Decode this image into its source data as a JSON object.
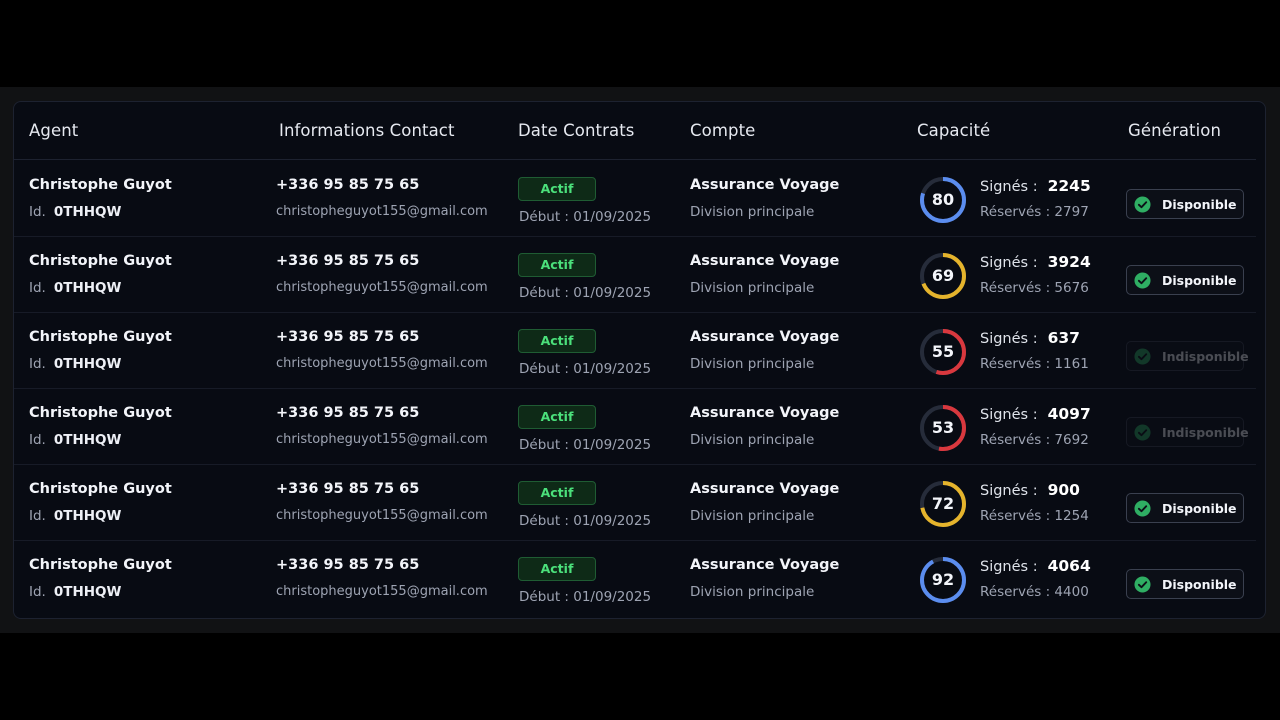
{
  "table": {
    "headers": {
      "agent": "Agent",
      "contact": "Informations Contact",
      "date": "Date Contrats",
      "compte": "Compte",
      "capacite": "Capacité",
      "generation": "Génération"
    },
    "id_prefix": "Id.",
    "signes_label": "Signés :",
    "rows": [
      {
        "name": "Christophe Guyot",
        "id": "0THHQW",
        "phone": "+336 95 85 75 65",
        "email": "christopheguyot155@gmail.com",
        "status": "Actif",
        "debut": "Début : 01/09/2025",
        "account": "Assurance Voyage",
        "division": "Division principale",
        "capacity": 80,
        "ring_color": "#5b8def",
        "signes": "2245",
        "reserves": "Réservés : 2797",
        "generation": "Disponible",
        "available": true
      },
      {
        "name": "Christophe Guyot",
        "id": "0THHQW",
        "phone": "+336 95 85 75 65",
        "email": "christopheguyot155@gmail.com",
        "status": "Actif",
        "debut": "Début : 01/09/2025",
        "account": "Assurance Voyage",
        "division": "Division principale",
        "capacity": 69,
        "ring_color": "#e5b42c",
        "signes": "3924",
        "reserves": "Réservés : 5676",
        "generation": "Disponible",
        "available": true
      },
      {
        "name": "Christophe Guyot",
        "id": "0THHQW",
        "phone": "+336 95 85 75 65",
        "email": "christopheguyot155@gmail.com",
        "status": "Actif",
        "debut": "Début : 01/09/2025",
        "account": "Assurance Voyage",
        "division": "Division principale",
        "capacity": 55,
        "ring_color": "#d9383e",
        "signes": "637",
        "reserves": "Réservés : 1161",
        "generation": "Indisponible",
        "available": false
      },
      {
        "name": "Christophe Guyot",
        "id": "0THHQW",
        "phone": "+336 95 85 75 65",
        "email": "christopheguyot155@gmail.com",
        "status": "Actif",
        "debut": "Début : 01/09/2025",
        "account": "Assurance Voyage",
        "division": "Division principale",
        "capacity": 53,
        "ring_color": "#d9383e",
        "signes": "4097",
        "reserves": "Réservés : 7692",
        "generation": "Indisponible",
        "available": false
      },
      {
        "name": "Christophe Guyot",
        "id": "0THHQW",
        "phone": "+336 95 85 75 65",
        "email": "christopheguyot155@gmail.com",
        "status": "Actif",
        "debut": "Début : 01/09/2025",
        "account": "Assurance Voyage",
        "division": "Division principale",
        "capacity": 72,
        "ring_color": "#e5b42c",
        "signes": "900",
        "reserves": "Réservés : 1254",
        "generation": "Disponible",
        "available": true
      },
      {
        "name": "Christophe Guyot",
        "id": "0THHQW",
        "phone": "+336 95 85 75 65",
        "email": "christopheguyot155@gmail.com",
        "status": "Actif",
        "debut": "Début : 01/09/2025",
        "account": "Assurance Voyage",
        "division": "Division principale",
        "capacity": 92,
        "ring_color": "#5b8def",
        "signes": "4064",
        "reserves": "Réservés : 4400",
        "generation": "Disponible",
        "available": true
      }
    ]
  },
  "colors": {
    "ring_track": "#262c3a",
    "check_fill": "#2fae63"
  }
}
